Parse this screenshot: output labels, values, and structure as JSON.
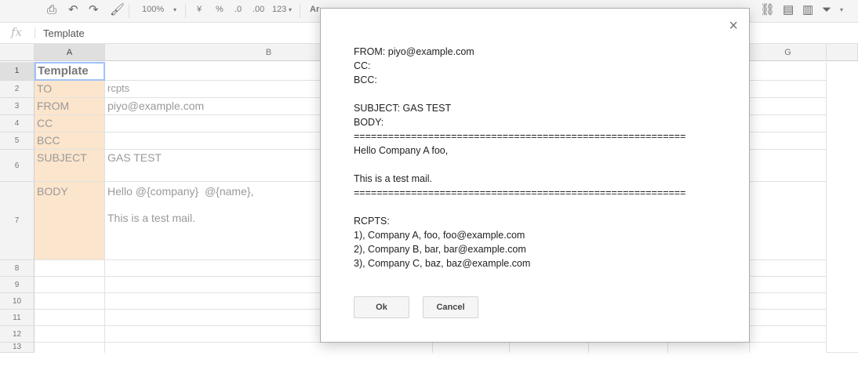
{
  "toolbar": {
    "zoom": "100%",
    "currency": "¥",
    "percent": "%",
    "dec_decrease": ".0",
    "dec_increase": ".00",
    "format_more": "123",
    "font": "Ar"
  },
  "formula_bar": {
    "fx": "fx",
    "value": "Template"
  },
  "columns": [
    "A",
    "B",
    "G"
  ],
  "rows": [
    "1",
    "2",
    "3",
    "4",
    "5",
    "6",
    "7",
    "8",
    "9",
    "10",
    "11",
    "12",
    "13"
  ],
  "sheet": {
    "a1": "Template",
    "labels": [
      "TO",
      "FROM",
      "CC",
      "BCC",
      "SUBJECT",
      "BODY"
    ],
    "values": [
      "rcpts",
      "piyo@example.com",
      "",
      "",
      "GAS TEST",
      "Hello @{company}  @{name},\n\nThis is a test mail."
    ]
  },
  "dialog": {
    "content": "FROM: piyo@example.com\nCC:\nBCC:\n\nSUBJECT: GAS TEST\nBODY:\n==========================================================\nHello Company A foo,\n\nThis is a test mail.\n==========================================================\n\nRCPTS:\n1), Company A, foo, foo@example.com\n2), Company B, bar, bar@example.com\n3), Company C, baz, baz@example.com",
    "ok_label": "Ok",
    "cancel_label": "Cancel",
    "close_glyph": "×"
  },
  "colors": {
    "label_fill": "#fce5cd",
    "selection": "#a1c2fa"
  }
}
